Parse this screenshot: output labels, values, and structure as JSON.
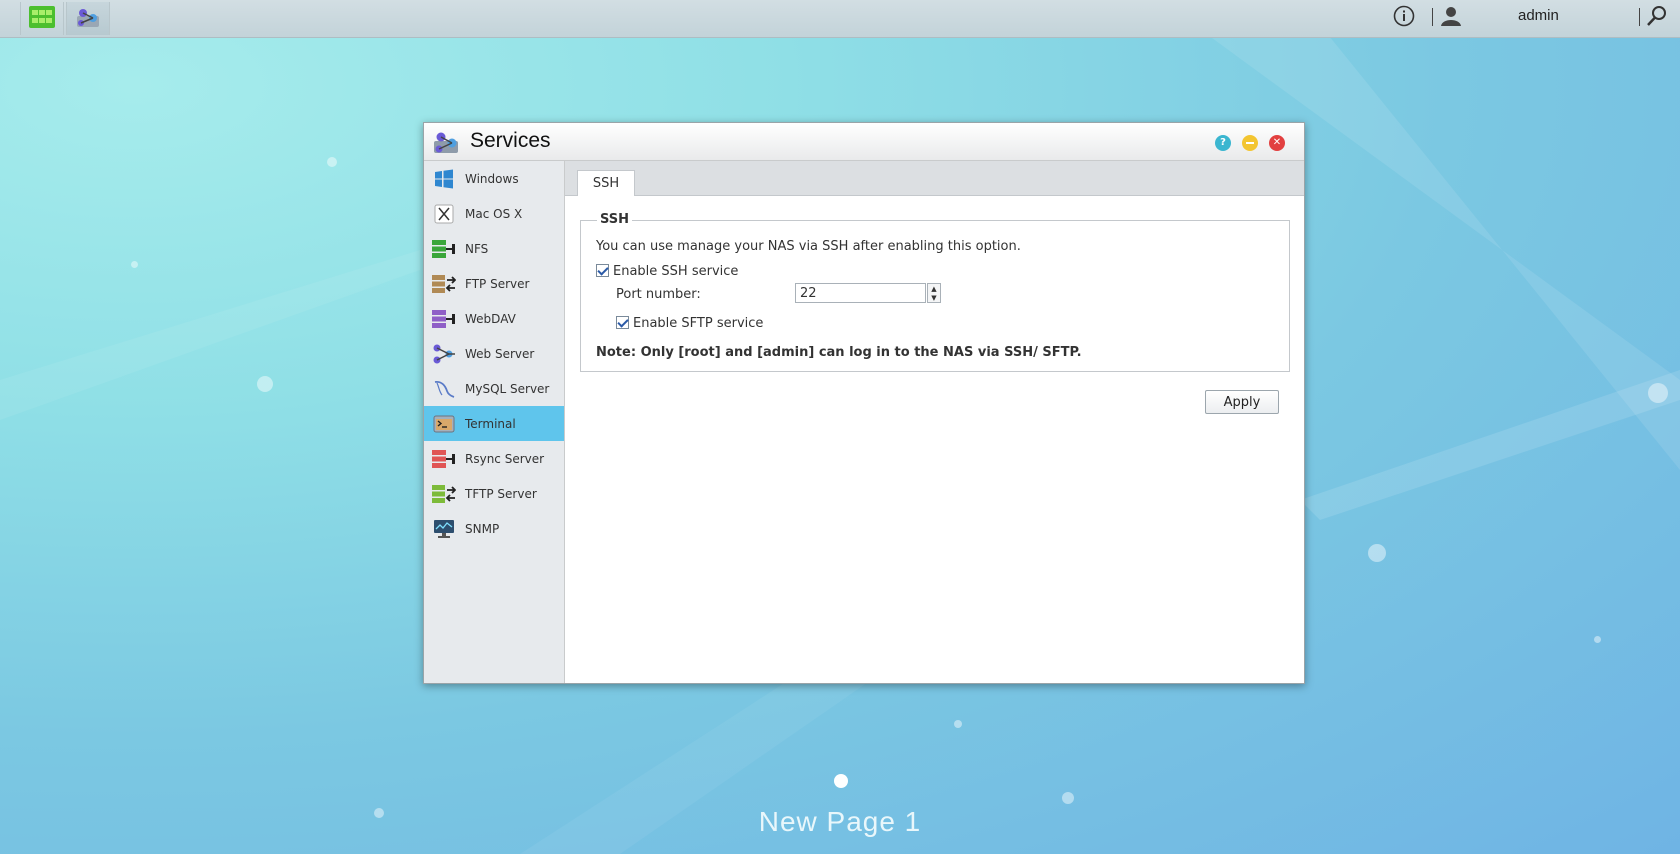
{
  "topbar": {
    "apps": [
      {
        "name": "App Center",
        "icon": "app-center-icon"
      },
      {
        "name": "Services",
        "icon": "services-icon"
      }
    ],
    "user": "admin",
    "icons": [
      "info-icon",
      "user-icon",
      "search-icon"
    ]
  },
  "window": {
    "title": "Services",
    "controls": [
      "help-icon",
      "minimize-icon",
      "close-icon"
    ]
  },
  "sidebar": {
    "items": [
      {
        "label": "Windows",
        "icon": "windows-icon"
      },
      {
        "label": "Mac OS X",
        "icon": "mac-icon"
      },
      {
        "label": "NFS",
        "icon": "nfs-icon"
      },
      {
        "label": "FTP Server",
        "icon": "ftp-icon"
      },
      {
        "label": "WebDAV",
        "icon": "webdav-icon"
      },
      {
        "label": "Web Server",
        "icon": "web-server-icon"
      },
      {
        "label": "MySQL Server",
        "icon": "mysql-icon"
      },
      {
        "label": "Terminal",
        "icon": "terminal-icon"
      },
      {
        "label": "Rsync Server",
        "icon": "rsync-icon"
      },
      {
        "label": "TFTP Server",
        "icon": "tftp-icon"
      },
      {
        "label": "SNMP",
        "icon": "snmp-icon"
      }
    ],
    "selected": "Terminal"
  },
  "tabs": [
    {
      "label": "SSH"
    }
  ],
  "ssh": {
    "legend": "SSH",
    "description": "You can use manage your NAS via SSH after enabling this option.",
    "enable_ssh_label": "Enable SSH service",
    "enable_ssh_checked": true,
    "port_label": "Port number:",
    "port_value": "22",
    "enable_sftp_label": "Enable SFTP service",
    "enable_sftp_checked": true,
    "note": "Note: Only [root] and [admin] can log in to the NAS via SSH/ SFTP."
  },
  "apply_label": "Apply",
  "desktop": {
    "page_label": "New Page 1"
  },
  "colors": {
    "selected": "#5fc5ec",
    "help": "#3bb6d0",
    "minimize": "#f3c531",
    "close": "#e24040"
  }
}
